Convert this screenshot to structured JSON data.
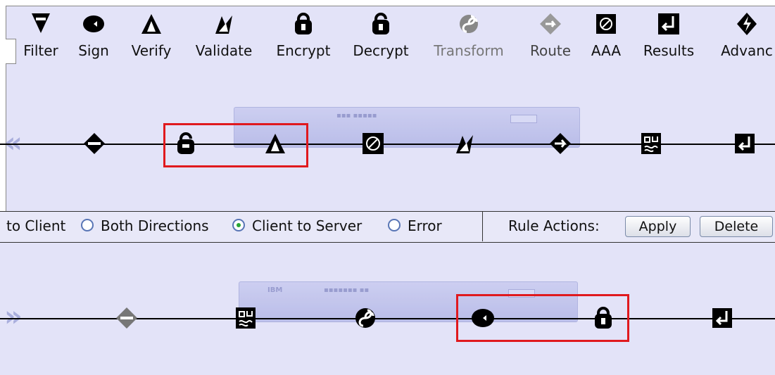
{
  "palette": {
    "items": [
      {
        "label": "Filter",
        "icon": "filter-icon"
      },
      {
        "label": "Sign",
        "icon": "sign-icon"
      },
      {
        "label": "Verify",
        "icon": "verify-icon"
      },
      {
        "label": "Validate",
        "icon": "validate-icon"
      },
      {
        "label": "Encrypt",
        "icon": "encrypt-icon"
      },
      {
        "label": "Decrypt",
        "icon": "decrypt-icon"
      },
      {
        "label": "Transform",
        "icon": "transform-icon"
      },
      {
        "label": "Route",
        "icon": "route-icon"
      },
      {
        "label": "AAA",
        "icon": "aaa-icon"
      },
      {
        "label": "Results",
        "icon": "results-icon"
      },
      {
        "label": "Advanc",
        "icon": "advanced-icon"
      }
    ]
  },
  "rules": {
    "upper": [
      "match",
      "decrypt",
      "verify",
      "aaa",
      "validate",
      "route",
      "transform",
      "results"
    ],
    "lower": [
      "match",
      "transform",
      "transform-swirl",
      "sign",
      "encrypt",
      "results"
    ]
  },
  "direction": {
    "to_client_label": "to Client",
    "both_label": "Both Directions",
    "client_to_server_label": "Client to Server",
    "error_label": "Error",
    "selected": "Client to Server"
  },
  "actions": {
    "label": "Rule Actions:",
    "apply_label": "Apply",
    "delete_label": "Delete"
  },
  "colors": {
    "canvas_bg": "#e3e3f8",
    "highlight": "#e0191e",
    "chevron": "#a9aedc",
    "selected_radio": "#2aa535"
  }
}
